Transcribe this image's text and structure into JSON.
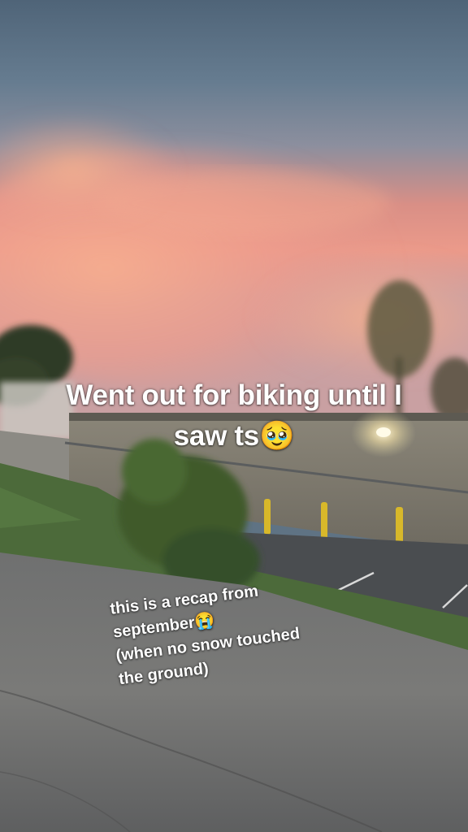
{
  "caption_main": {
    "line1": "Went out for biking until I",
    "line2": "saw ts🥹"
  },
  "caption_secondary": {
    "line1": "this is a recap from",
    "line2": "september😭",
    "line3": "(when no snow touched",
    "line4": "the ground)"
  }
}
